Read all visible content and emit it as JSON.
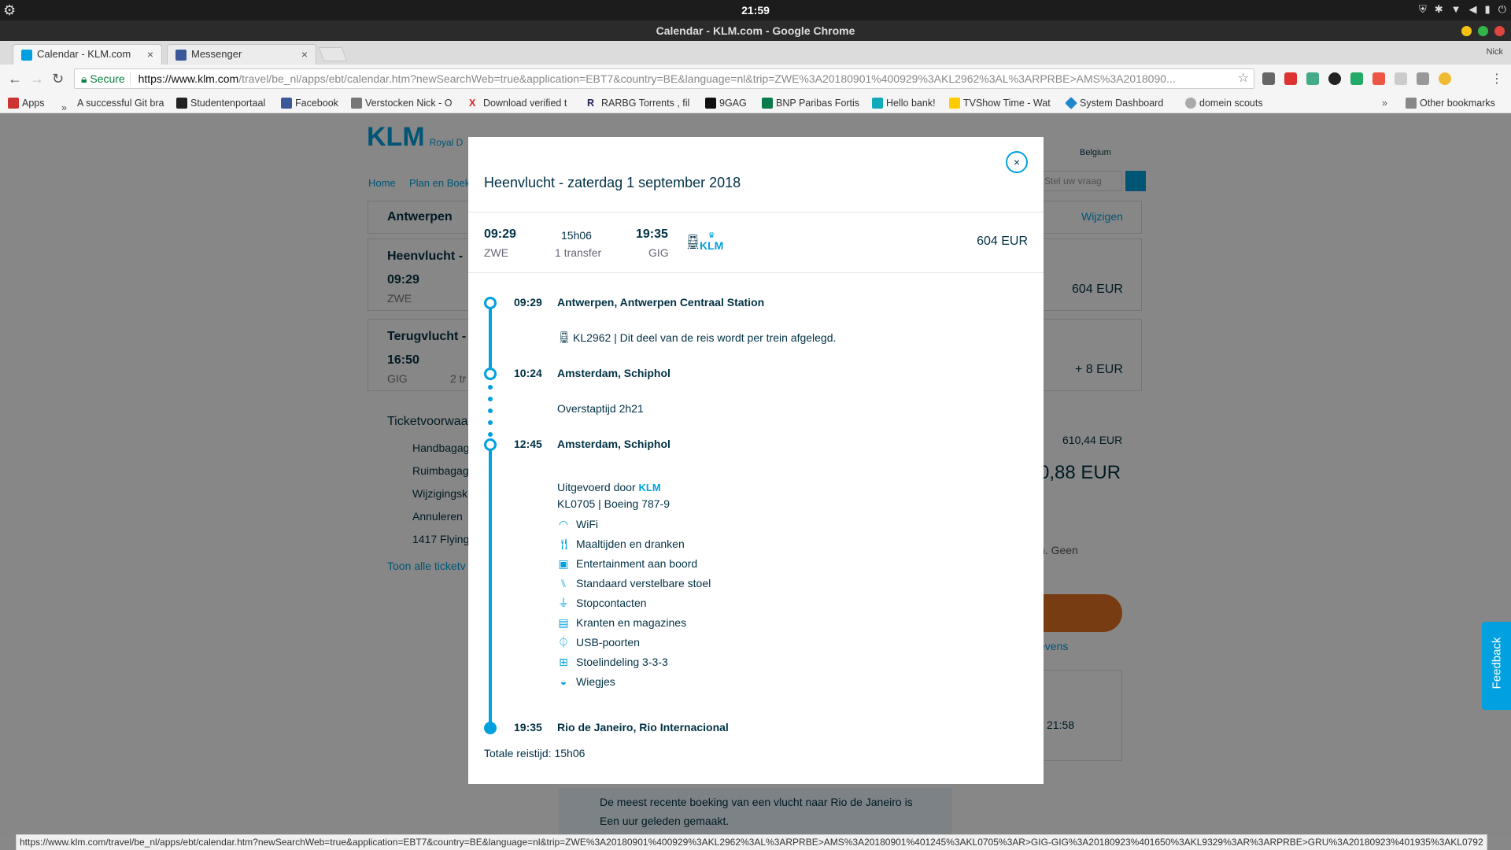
{
  "system": {
    "clock": "21:59"
  },
  "window": {
    "title": "Calendar - KLM.com - Google Chrome",
    "profile": "Nick"
  },
  "tabs": [
    {
      "label": "Calendar - KLM.com",
      "active": true
    },
    {
      "label": "Messenger",
      "active": false
    }
  ],
  "omnibox": {
    "secure_label": "Secure",
    "url_host": "https://www.klm.com",
    "url_path": "/travel/be_nl/apps/ebt/calendar.htm?newSearchWeb=true&application=EBT7&country=BE&language=nl&trip=ZWE%3A20180901%400929%3AKL2962%3AL%3ARPRBE>AMS%3A2018090..."
  },
  "bookmarks": [
    {
      "label": "Apps"
    },
    {
      "label": "A successful Git bra"
    },
    {
      "label": "Studentenportaal"
    },
    {
      "label": "Facebook"
    },
    {
      "label": "Verstocken Nick - O"
    },
    {
      "label": "Download verified t"
    },
    {
      "label": "RARBG Torrents , fil"
    },
    {
      "label": "9GAG"
    },
    {
      "label": "BNP Paribas Fortis"
    },
    {
      "label": "Hello bank!"
    },
    {
      "label": "TVShow Time - Wat"
    },
    {
      "label": "System Dashboard"
    },
    {
      "label": "domein scouts"
    },
    {
      "label": "Other bookmarks"
    }
  ],
  "background_page": {
    "logo": "KLM",
    "logo_sub": "Royal D",
    "country": "Belgium",
    "nav_home": "Home",
    "nav_plan": "Plan en Boek",
    "search_placeholder": "Stel uw vraag",
    "route": "Antwerpen",
    "change": "Wijzigen",
    "outbound_label": "Heenvlucht -",
    "outbound_time": "09:29",
    "outbound_code": "ZWE",
    "outbound_price": "604 EUR",
    "return_label": "Terugvlucht -",
    "return_time": "16:50",
    "return_code": "GIG",
    "return_transfers": "2 tr",
    "return_price": "+ 8 EUR",
    "ticket_heading": "Ticketvoorwaa",
    "ticket_items": [
      "Handbagag",
      "Ruimbagag",
      "Wijzigingsk",
      "Annuleren",
      "1417 Flying"
    ],
    "ticket_link": "Toon alle ticketv",
    "subtotal": "610,44 EUR",
    "total_partial": "0,88 EUR",
    "note": "n. Geen",
    "gegevens": "evens",
    "time_box": "21:58",
    "notice_line1": "De meest recente boeking van een vlucht naar Rio de Janeiro is",
    "notice_line2": "Een uur geleden gemaakt."
  },
  "modal": {
    "title": "Heenvlucht - zaterdag 1 september 2018",
    "close_symbol": "×",
    "summary": {
      "dep_time": "09:29",
      "dep_code": "ZWE",
      "duration": "15h06",
      "transfers": "1 transfer",
      "arr_time": "19:35",
      "arr_code": "GIG",
      "carrier": "KLM",
      "price": "604 EUR"
    },
    "stops": [
      {
        "time": "09:29",
        "place": "Antwerpen, Antwerpen Centraal Station"
      },
      {
        "time": "10:24",
        "place": "Amsterdam, Schiphol"
      },
      {
        "time": "12:45",
        "place": "Amsterdam, Schiphol"
      },
      {
        "time": "19:35",
        "place": "Rio de Janeiro, Rio Internacional"
      }
    ],
    "train_segment": "KL2962 | Dit deel van de reis wordt per trein afgelegd.",
    "transfer_time": "Overstaptijd 2h21",
    "operated_by": "Uitgevoerd door",
    "operated_carrier": "KLM",
    "flight_info": "KL0705 | Boeing 787-9",
    "features": [
      {
        "icon": "wifi-icon",
        "label": "WiFi"
      },
      {
        "icon": "meal-icon",
        "label": "Maaltijden en dranken"
      },
      {
        "icon": "entertainment-icon",
        "label": "Entertainment aan boord"
      },
      {
        "icon": "seat-icon",
        "label": "Standaard verstelbare stoel"
      },
      {
        "icon": "power-icon",
        "label": "Stopcontacten"
      },
      {
        "icon": "newspaper-icon",
        "label": "Kranten en magazines"
      },
      {
        "icon": "usb-icon",
        "label": "USB-poorten"
      },
      {
        "icon": "seating-layout-icon",
        "label": "Stoelindeling 3-3-3"
      },
      {
        "icon": "cradle-icon",
        "label": "Wiegjes"
      }
    ],
    "total": "Totale reistijd: 15h06"
  },
  "feedback_label": "Feedback",
  "status_url": "https://www.klm.com/travel/be_nl/apps/ebt/calendar.htm?newSearchWeb=true&application=EBT7&country=BE&language=nl&trip=ZWE%3A20180901%400929%3AKL2962%3AL%3ARPRBE>AMS%3A20180901%401245%3AKL0705%3AR>GIG-GIG%3A20180923%401650%3AKL9329%3AR%3ARPRBE>GRU%3A20180923%401935%3AKL0792",
  "colors": {
    "klm_blue": "#00a1de",
    "klm_navy": "#003145",
    "cta_orange": "#e37222"
  }
}
